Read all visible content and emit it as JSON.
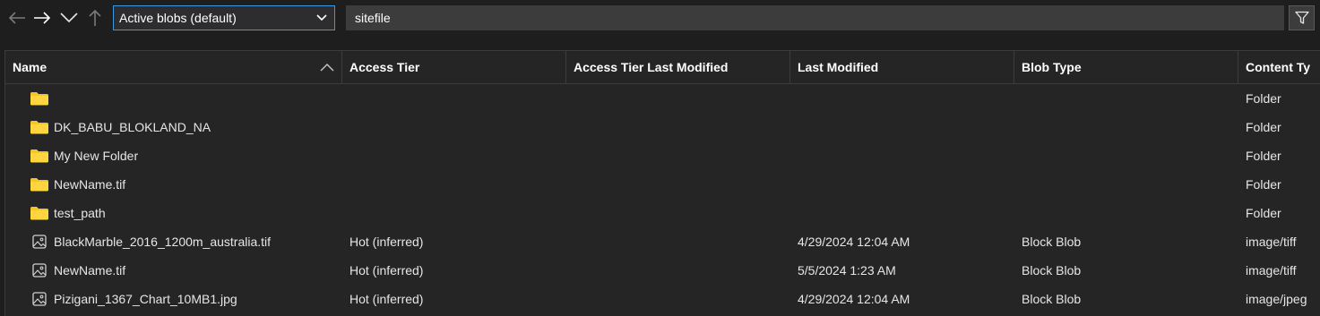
{
  "toolbar": {
    "back_icon": "arrow-left-icon",
    "forward_icon": "arrow-right-icon",
    "expand_icon": "chevron-down-icon",
    "up_icon": "arrow-up-icon",
    "view_select_value": "Active blobs (default)",
    "search_value": "sitefile",
    "filter_icon": "filter-icon"
  },
  "table": {
    "columns": [
      "Name",
      "Access Tier",
      "Access Tier Last Modified",
      "Last Modified",
      "Blob Type",
      "Content Ty"
    ],
    "sort_icon": "chevron-up-icon",
    "rows": [
      {
        "icon": "folder-icon",
        "name": "",
        "tier": "",
        "tier_modified": "",
        "modified": "",
        "blob_type": "",
        "content_type": "Folder"
      },
      {
        "icon": "folder-icon",
        "name": "DK_BABU_BLOKLAND_NA",
        "tier": "",
        "tier_modified": "",
        "modified": "",
        "blob_type": "",
        "content_type": "Folder"
      },
      {
        "icon": "folder-icon",
        "name": "My New Folder",
        "tier": "",
        "tier_modified": "",
        "modified": "",
        "blob_type": "",
        "content_type": "Folder"
      },
      {
        "icon": "folder-icon",
        "name": "NewName.tif",
        "tier": "",
        "tier_modified": "",
        "modified": "",
        "blob_type": "",
        "content_type": "Folder"
      },
      {
        "icon": "folder-icon",
        "name": "test_path",
        "tier": "",
        "tier_modified": "",
        "modified": "",
        "blob_type": "",
        "content_type": "Folder"
      },
      {
        "icon": "image-file-icon",
        "name": "BlackMarble_2016_1200m_australia.tif",
        "tier": "Hot (inferred)",
        "tier_modified": "",
        "modified": "4/29/2024 12:04 AM",
        "blob_type": "Block Blob",
        "content_type": "image/tiff"
      },
      {
        "icon": "image-file-icon",
        "name": "NewName.tif",
        "tier": "Hot (inferred)",
        "tier_modified": "",
        "modified": "5/5/2024 1:23 AM",
        "blob_type": "Block Blob",
        "content_type": "image/tiff"
      },
      {
        "icon": "image-file-icon",
        "name": "Pizigani_1367_Chart_10MB1.jpg",
        "tier": "Hot (inferred)",
        "tier_modified": "",
        "modified": "4/29/2024 12:04 AM",
        "blob_type": "Block Blob",
        "content_type": "image/jpeg"
      }
    ]
  },
  "colors": {
    "background": "#1e1e1e",
    "grid_background": "#252526",
    "accent": "#3a96dd",
    "folder": "#f7c32b"
  }
}
